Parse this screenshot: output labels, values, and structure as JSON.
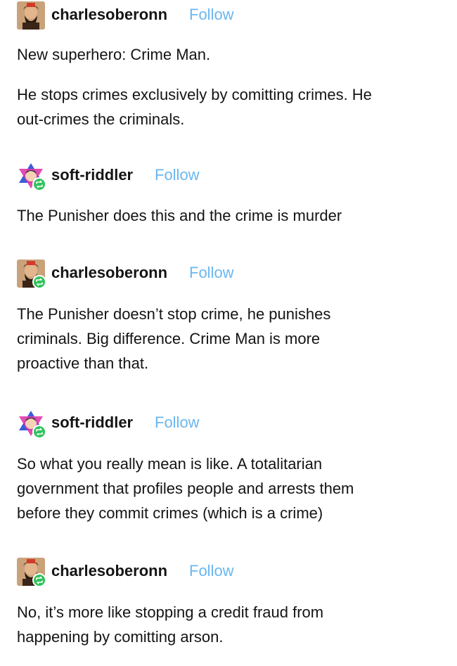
{
  "posts": [
    {
      "username": "charlesoberonn",
      "follow_label": "Follow",
      "avatar": "charlesoberonn-avatar",
      "reblog": false,
      "paragraphs": [
        "New superhero: Crime Man.",
        "He stops crimes exclusively by comitting crimes. He",
        "out-crimes the criminals."
      ]
    },
    {
      "username": "soft-riddler",
      "follow_label": "Follow",
      "avatar": "soft-riddler-avatar",
      "reblog": true,
      "paragraphs": [
        "The Punisher does this and the crime is murder"
      ]
    },
    {
      "username": "charlesoberonn",
      "follow_label": "Follow",
      "avatar": "charlesoberonn-avatar",
      "reblog": true,
      "paragraphs": [
        "The Punisher doesn’t stop crime, he punishes",
        "criminals. Big difference.  Crime Man is more",
        "proactive than that."
      ]
    },
    {
      "username": "soft-riddler",
      "follow_label": "Follow",
      "avatar": "soft-riddler-avatar",
      "reblog": true,
      "paragraphs": [
        "So what you really mean is like. A totalitarian",
        "government that profiles people and arrests them",
        "before they commit crimes (which is a crime)"
      ]
    },
    {
      "username": "charlesoberonn",
      "follow_label": "Follow",
      "avatar": "charlesoberonn-avatar",
      "reblog": true,
      "paragraphs": [
        "No, it’s more like stopping a credit fraud from",
        "happening by comitting arson."
      ]
    }
  ],
  "colors": {
    "follow": "#6ab7ef",
    "reblog_badge": "#2ec35a",
    "text": "#141414"
  },
  "icons": {
    "reblog": "reblog-icon"
  }
}
